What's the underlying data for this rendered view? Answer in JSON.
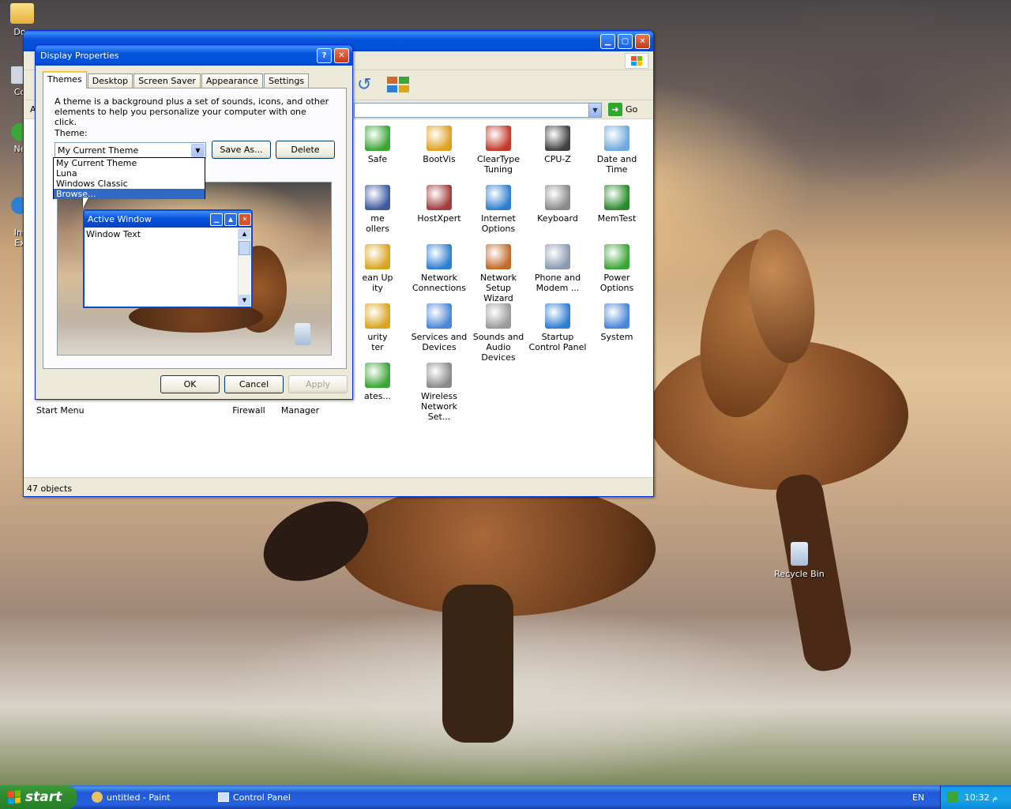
{
  "desktop": {
    "icons": [
      {
        "label": "Doc"
      },
      {
        "label": "Co"
      },
      {
        "label": "Ne"
      },
      {
        "label": "Int\nEx"
      },
      {
        "label": "Recycle Bin"
      }
    ]
  },
  "control_panel": {
    "menu_hint": "A",
    "address_go_label": "Go",
    "items": [
      {
        "label": "Safe",
        "icon": "safe-icon",
        "color": "#3aa635"
      },
      {
        "label": "BootVis",
        "icon": "runner-icon",
        "color": "#e0a020"
      },
      {
        "label": "ClearType\nTuning",
        "icon": "cleartype-icon",
        "color": "#c23a2a"
      },
      {
        "label": "CPU-Z",
        "icon": "cpu-icon",
        "color": "#404040"
      },
      {
        "label": "Date and Time",
        "icon": "clock-icon",
        "color": "#6fa8dc"
      },
      {
        "label": "me\nollers",
        "icon": "gamecontroller-icon",
        "color": "#3d5a9e"
      },
      {
        "label": "HostXpert",
        "icon": "books-icon",
        "color": "#a03c3c"
      },
      {
        "label": "Internet\nOptions",
        "icon": "globe-icon",
        "color": "#2f7fd0"
      },
      {
        "label": "Keyboard",
        "icon": "keyboard-icon",
        "color": "#8a8a8a"
      },
      {
        "label": "MemTest",
        "icon": "memory-icon",
        "color": "#2c8a2c"
      },
      {
        "label": "ean Up\nity",
        "icon": "cleanup-icon",
        "color": "#d9a520"
      },
      {
        "label": "Network\nConnections",
        "icon": "network-icon",
        "color": "#2f7fd0"
      },
      {
        "label": "Network Setup\nWizard",
        "icon": "house-icon",
        "color": "#c26a2a"
      },
      {
        "label": "Phone and\nModem ...",
        "icon": "phone-icon",
        "color": "#8a9ab0"
      },
      {
        "label": "Power Options",
        "icon": "battery-icon",
        "color": "#3aa635"
      },
      {
        "label": "urity\nter",
        "icon": "shield-icon",
        "color": "#d9a520"
      },
      {
        "label": "Services and\nDevices",
        "icon": "services-icon",
        "color": "#4a86d8"
      },
      {
        "label": "Sounds and\nAudio Devices",
        "icon": "speaker-icon",
        "color": "#9a9a9a"
      },
      {
        "label": "Startup\nControl Panel",
        "icon": "monitor-icon",
        "color": "#2f7fd0"
      },
      {
        "label": "System",
        "icon": "system-icon",
        "color": "#4a86d8"
      },
      {
        "label": "ates...",
        "icon": "update-icon",
        "color": "#3aa635"
      },
      {
        "label": "Wireless\nNetwork Set...",
        "icon": "wireless-icon",
        "color": "#8a8a8a"
      },
      {
        "label": "Start Menu",
        "icon": "",
        "color": ""
      },
      {
        "label": "Firewall",
        "icon": "",
        "color": ""
      },
      {
        "label": "Manager",
        "icon": "",
        "color": ""
      }
    ],
    "status": "47 objects"
  },
  "display_properties": {
    "title": "Display Properties",
    "tabs": [
      "Themes",
      "Desktop",
      "Screen Saver",
      "Appearance",
      "Settings"
    ],
    "description": "A theme is a background plus a set of sounds, icons, and other elements to help you personalize your computer with one click.",
    "theme_label": "Theme:",
    "theme_value": "My Current Theme",
    "save_as": "Save As...",
    "delete": "Delete",
    "dropdown_options": [
      "My Current Theme",
      "Luna",
      "Windows Classic",
      "Browse..."
    ],
    "dropdown_selected": "Browse...",
    "preview": {
      "window_title": "Active Window",
      "window_text": "Window Text"
    },
    "ok": "OK",
    "cancel": "Cancel",
    "apply": "Apply"
  },
  "taskbar": {
    "start": "start",
    "tasks": [
      {
        "label": "untitled - Paint"
      },
      {
        "label": "Control Panel"
      }
    ],
    "language": "EN",
    "clock": "10:32 م"
  }
}
